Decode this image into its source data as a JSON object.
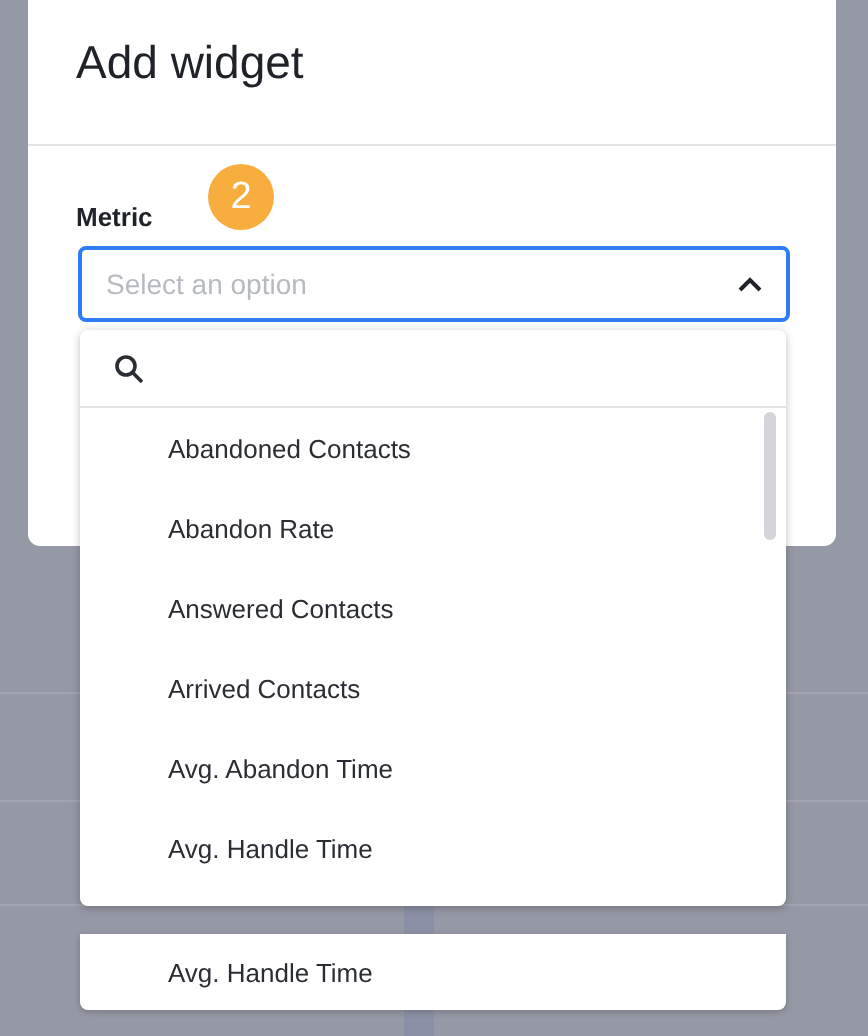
{
  "dialog": {
    "title": "Add widget"
  },
  "field": {
    "label": "Metric",
    "badge": "2",
    "placeholder": "Select an option",
    "expanded": true
  },
  "dropdown": {
    "options": [
      {
        "label": "Abandoned Contacts"
      },
      {
        "label": "Abandon Rate"
      },
      {
        "label": "Answered Contacts"
      },
      {
        "label": "Arrived Contacts"
      },
      {
        "label": "Avg. Abandon Time"
      },
      {
        "label": "Avg. Handle Time"
      }
    ]
  },
  "callout": {
    "label": "Avg. Handle Time"
  }
}
